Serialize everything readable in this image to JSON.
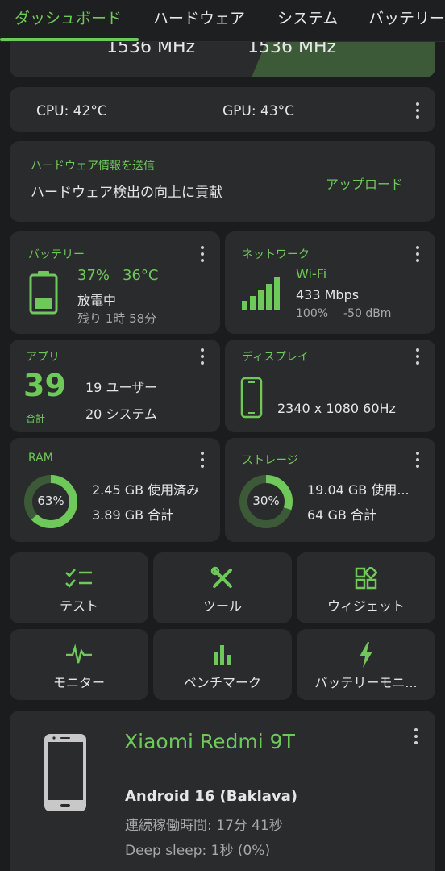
{
  "tabs": [
    "ダッシュボード",
    "ハードウェア",
    "システム",
    "バッテリー"
  ],
  "freq": {
    "left": "1536 MHz",
    "right": "1536 MHz"
  },
  "temps": {
    "cpu": "CPU: 42°C",
    "gpu": "GPU: 43°C"
  },
  "submit": {
    "title": "ハードウェア情報を送信",
    "body": "ハードウェア検出の向上に貢献",
    "action": "アップロード"
  },
  "battery": {
    "title": "バッテリー",
    "percent": "37%",
    "temp": "36°C",
    "status": "放電中",
    "remaining": "残り 1時 58分",
    "level": 0.37
  },
  "network": {
    "title": "ネットワーク",
    "type": "Wi-Fi",
    "speed": "433 Mbps",
    "signal": "100%",
    "dbm": "-50 dBm"
  },
  "apps": {
    "title": "アプリ",
    "count": "39",
    "count_label": "合計",
    "user": "19 ユーザー",
    "system": "20 システム"
  },
  "display": {
    "title": "ディスプレイ",
    "info": "2340 x 1080  60Hz"
  },
  "ram": {
    "title": "RAM",
    "percent": "63%",
    "level": 0.63,
    "used": "2.45 GB 使用済み",
    "total": "3.89 GB 合計"
  },
  "storage": {
    "title": "ストレージ",
    "percent": "30%",
    "level": 0.3,
    "used": "19.04 GB 使用...",
    "total": "64 GB 合計"
  },
  "tiles": [
    "テスト",
    "ツール",
    "ウィジェット",
    "モニター",
    "ベンチマーク",
    "バッテリーモニ..."
  ],
  "device": {
    "name": "Xiaomi Redmi 9T",
    "android": "Android 16 (Baklava)",
    "uptime": "連続稼働時間: 17分 41秒",
    "deep_sleep": "Deep sleep: 1秒 (0%)"
  },
  "colors": {
    "accent": "#6fc95a",
    "card": "#2a2b2c",
    "background": "#1b1c1d"
  }
}
